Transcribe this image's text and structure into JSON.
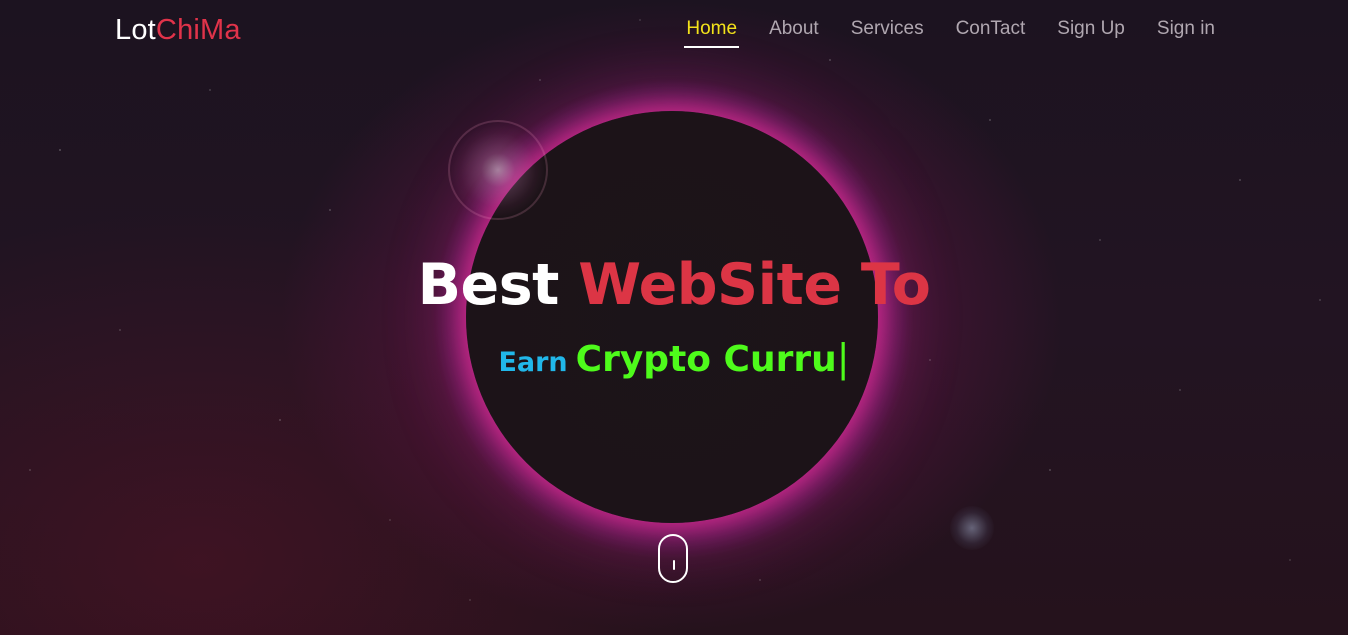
{
  "navbar": {
    "brand_part1": "Lot",
    "brand_part2": "ChiMa",
    "items": [
      {
        "label": "Home",
        "active": true
      },
      {
        "label": "About",
        "active": false
      },
      {
        "label": "Services",
        "active": false
      },
      {
        "label": "ConTact",
        "active": false
      },
      {
        "label": "Sign Up",
        "active": false
      },
      {
        "label": "Sign in",
        "active": false
      }
    ]
  },
  "hero": {
    "headline_white": "Best",
    "headline_red": "WebSite To",
    "sub_prefix": "Earn",
    "sub_typed": "Crypto Curru",
    "caret": "|",
    "scroll_icon": "mouse-scroll-icon"
  },
  "colors": {
    "brand_accent": "#e0334a",
    "nav_active": "#f3e21a",
    "nav_default": "#b0a7b0",
    "headline_red": "#dc3545",
    "earn_blue": "#21b7e9",
    "typed_green": "#4efb1b"
  }
}
